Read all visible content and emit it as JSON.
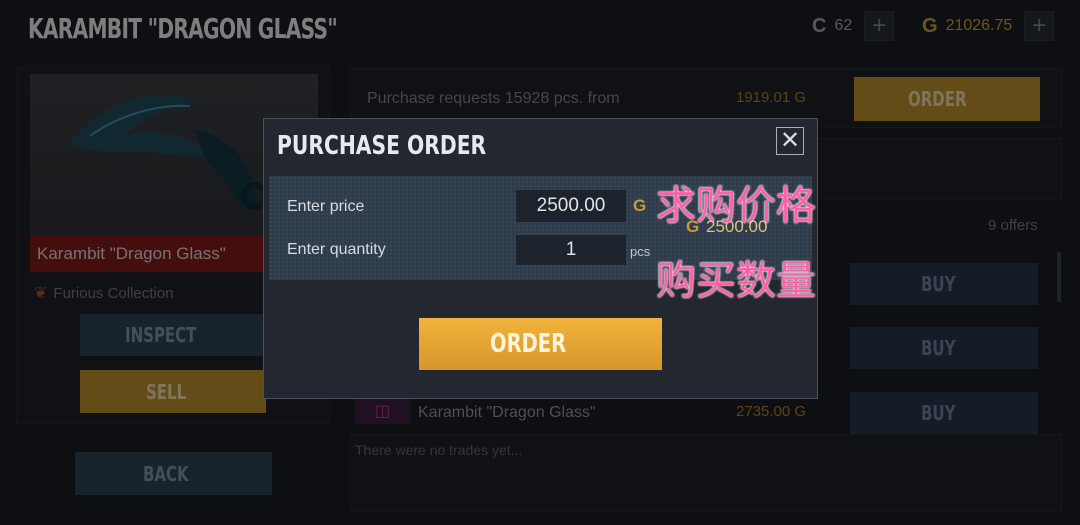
{
  "header": {
    "title": "KARAMBIT \"DRAGON GLASS\"",
    "credits": {
      "symbol": "C",
      "value": "62"
    },
    "gold": {
      "symbol": "G",
      "value": "21026.75"
    },
    "plus": "+"
  },
  "item": {
    "name": "Karambit \"Dragon Glass\"",
    "collection": "Furious Collection",
    "inspect_label": "INSPECT",
    "sell_label": "SELL",
    "back_label": "BACK"
  },
  "market": {
    "request_text": "Purchase requests 15928 pcs. from",
    "request_price": "1919.01 G",
    "order_label": "ORDER",
    "offers_count": "9 offers",
    "buy_label": "BUY",
    "row3_name": "Karambit \"Dragon Glass\"",
    "row3_price": "2735.00 G",
    "trades_empty": "There were no trades yet..."
  },
  "modal": {
    "title": "PURCHASE ORDER",
    "close": "✕",
    "price_label": "Enter price",
    "price_value": "2500.00",
    "price_unit": "G",
    "qty_label": "Enter quantity",
    "qty_value": "1",
    "qty_unit": "pcs",
    "total_symbol": "G",
    "total_value": "2500.00",
    "order_label": "ORDER"
  },
  "annotations": {
    "price_note": "求购价格",
    "qty_note": "购买数量"
  },
  "colors": {
    "gold": "#c79a3a",
    "order_button": "#e6a733",
    "annotation": "#ff5fa6"
  }
}
